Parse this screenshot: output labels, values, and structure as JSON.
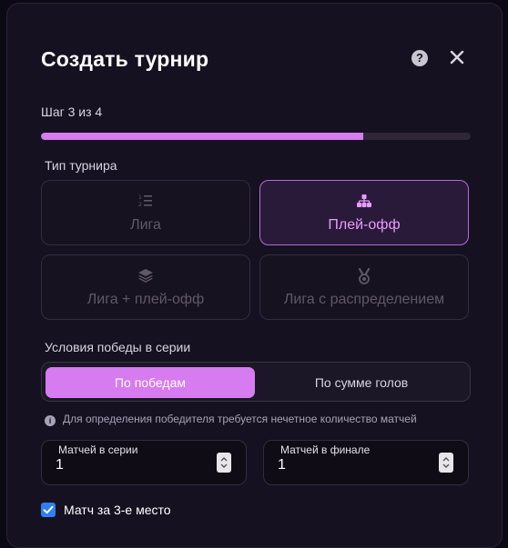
{
  "dialog": {
    "title": "Создать турнир",
    "help_label": "?",
    "step_text": "Шаг 3 из 4",
    "progress": 0.75
  },
  "tournament_type": {
    "label": "Тип турнира",
    "options": [
      {
        "label": "Лига",
        "icon": "list-ordered-icon",
        "selected": false
      },
      {
        "label": "Плей-офф",
        "icon": "bracket-tree-icon",
        "selected": true
      },
      {
        "label": "Лига + плей-офф",
        "icon": "layers-icon",
        "selected": false
      },
      {
        "label": "Лига с распределением",
        "icon": "medal-icon",
        "selected": false
      }
    ]
  },
  "win_conditions": {
    "label": "Условия победы в серии",
    "options": [
      "По победам",
      "По сумме голов"
    ],
    "selected_index": 0,
    "info_icon": "i",
    "info": "Для определения победителя требуется нечетное количество матчей"
  },
  "fields": {
    "series_matches": {
      "label": "Матчей в серии",
      "value": "1"
    },
    "final_matches": {
      "label": "Матчей в финале",
      "value": "1"
    }
  },
  "third_place": {
    "label": "Матч за 3-е место",
    "checked": true
  },
  "colors": {
    "accent": "#d67bf0",
    "background": "#161120",
    "checkbox": "#2f7ff7"
  }
}
